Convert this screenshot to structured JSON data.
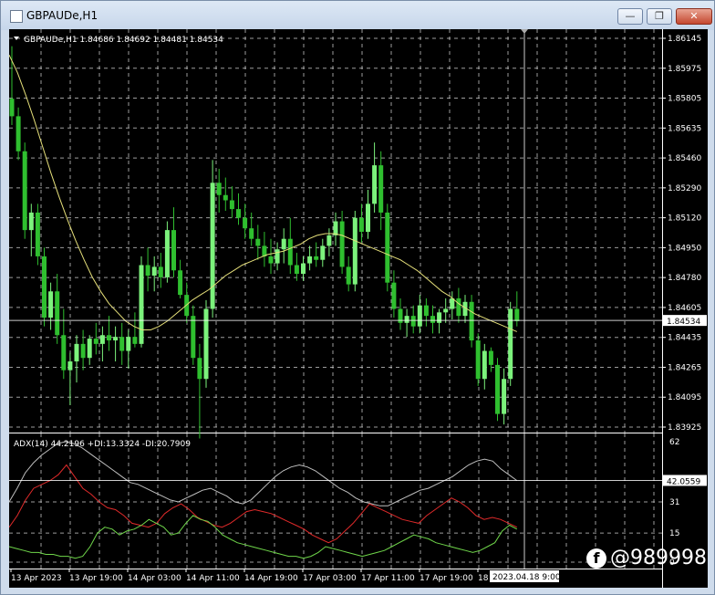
{
  "window": {
    "title": "GBPAUDe,H1",
    "minimize_glyph": "—",
    "restore_glyph": "❐",
    "close_glyph": "✕"
  },
  "main_panel": {
    "header": "GBPAUDe,H1  1.84686 1.84692 1.84481 1.84534",
    "price_labels": [
      "1.86145",
      "1.85975",
      "1.85805",
      "1.85635",
      "1.85460",
      "1.85290",
      "1.85120",
      "1.84950",
      "1.84780",
      "1.84605",
      "1.84435",
      "1.84265",
      "1.84095",
      "1.83925"
    ],
    "current_price": "1.84534"
  },
  "adx_panel": {
    "header": "ADX(14) 44.2196 +DI:13.3324 -DI:20.7909",
    "level_labels": [
      "62",
      "31",
      "15",
      "0"
    ],
    "current_value": "42.0559"
  },
  "time_axis": {
    "labels": [
      "13 Apr 2023",
      "13 Apr 19:00",
      "14 Apr 03:00",
      "14 Apr 11:00",
      "14 Apr 19:00",
      "17 Apr 03:00",
      "17 Apr 11:00",
      "17 Apr 19:00",
      "18"
    ],
    "crosshair_time": "2023.04.18 9:00"
  },
  "colors": {
    "bull": "#7cf27c",
    "bear": "#2fbf2f",
    "ma": "#e6e07a",
    "adx": "#bfbfbf",
    "plus_di": "#6fd64a",
    "minus_di": "#e02a2a",
    "grid": "#d0d0d0"
  },
  "watermark": {
    "icon": "f",
    "text": "@989998"
  },
  "chart_data": {
    "type": "candlestick",
    "x_range": [
      "2023-04-13",
      "2023-04-18 09:00"
    ],
    "y_range": [
      1.83925,
      1.86145
    ],
    "ohlc": [
      [
        1.858,
        1.861,
        1.8565,
        1.857
      ],
      [
        1.857,
        1.8575,
        1.8545,
        1.855
      ],
      [
        1.855,
        1.8555,
        1.85,
        1.8505
      ],
      [
        1.8505,
        1.852,
        1.849,
        1.8515
      ],
      [
        1.8515,
        1.852,
        1.8485,
        1.849
      ],
      [
        1.849,
        1.8495,
        1.845,
        1.8455
      ],
      [
        1.8455,
        1.8475,
        1.8448,
        1.847
      ],
      [
        1.847,
        1.848,
        1.844,
        1.8445
      ],
      [
        1.8445,
        1.846,
        1.842,
        1.8425
      ],
      [
        1.8425,
        1.8435,
        1.8405,
        1.843
      ],
      [
        1.843,
        1.8445,
        1.8418,
        1.844
      ],
      [
        1.844,
        1.8448,
        1.8425,
        1.8432
      ],
      [
        1.8432,
        1.8445,
        1.8428,
        1.8443
      ],
      [
        1.8443,
        1.8452,
        1.8434,
        1.844
      ],
      [
        1.844,
        1.845,
        1.843,
        1.8445
      ],
      [
        1.8445,
        1.8456,
        1.8436,
        1.8442
      ],
      [
        1.8442,
        1.845,
        1.843,
        1.8444
      ],
      [
        1.8444,
        1.8452,
        1.8428,
        1.8436
      ],
      [
        1.8436,
        1.8448,
        1.8426,
        1.8444
      ],
      [
        1.8444,
        1.8458,
        1.8438,
        1.844
      ],
      [
        1.844,
        1.849,
        1.8438,
        1.8485
      ],
      [
        1.8485,
        1.8495,
        1.847,
        1.8479
      ],
      [
        1.8479,
        1.849,
        1.847,
        1.8484
      ],
      [
        1.8484,
        1.8492,
        1.8472,
        1.8478
      ],
      [
        1.8478,
        1.851,
        1.8475,
        1.8505
      ],
      [
        1.8505,
        1.8518,
        1.8478,
        1.8482
      ],
      [
        1.8482,
        1.8488,
        1.8466,
        1.8468
      ],
      [
        1.8468,
        1.8475,
        1.8452,
        1.8456
      ],
      [
        1.8456,
        1.8462,
        1.8428,
        1.8432
      ],
      [
        1.8432,
        1.844,
        1.8386,
        1.842
      ],
      [
        1.842,
        1.8465,
        1.8415,
        1.846
      ],
      [
        1.846,
        1.8545,
        1.8455,
        1.8532
      ],
      [
        1.8532,
        1.854,
        1.8515,
        1.8525
      ],
      [
        1.8525,
        1.8535,
        1.8516,
        1.8522
      ],
      [
        1.8522,
        1.853,
        1.8512,
        1.8517
      ],
      [
        1.8517,
        1.8526,
        1.8508,
        1.8512
      ],
      [
        1.8512,
        1.852,
        1.85,
        1.8506
      ],
      [
        1.8506,
        1.8515,
        1.8496,
        1.85
      ],
      [
        1.85,
        1.8508,
        1.8488,
        1.8496
      ],
      [
        1.8496,
        1.8504,
        1.8484,
        1.849
      ],
      [
        1.849,
        1.85,
        1.848,
        1.8486
      ],
      [
        1.8486,
        1.8498,
        1.8482,
        1.8494
      ],
      [
        1.8494,
        1.8506,
        1.8486,
        1.85
      ],
      [
        1.85,
        1.8512,
        1.848,
        1.8485
      ],
      [
        1.8485,
        1.8492,
        1.8476,
        1.848
      ],
      [
        1.848,
        1.849,
        1.8476,
        1.8486
      ],
      [
        1.8486,
        1.8496,
        1.8482,
        1.849
      ],
      [
        1.849,
        1.8498,
        1.8484,
        1.8488
      ],
      [
        1.8488,
        1.85,
        1.8484,
        1.8496
      ],
      [
        1.8496,
        1.8506,
        1.849,
        1.8502
      ],
      [
        1.8502,
        1.8515,
        1.8496,
        1.851
      ],
      [
        1.851,
        1.8516,
        1.848,
        1.8484
      ],
      [
        1.8484,
        1.849,
        1.847,
        1.8474
      ],
      [
        1.8474,
        1.8516,
        1.847,
        1.8512
      ],
      [
        1.8512,
        1.852,
        1.8498,
        1.8504
      ],
      [
        1.8504,
        1.8528,
        1.85,
        1.852
      ],
      [
        1.852,
        1.8555,
        1.8515,
        1.8542
      ],
      [
        1.8542,
        1.855,
        1.8505,
        1.8515
      ],
      [
        1.8515,
        1.852,
        1.847,
        1.8475
      ],
      [
        1.8475,
        1.8482,
        1.8455,
        1.846
      ],
      [
        1.846,
        1.8466,
        1.8448,
        1.8452
      ],
      [
        1.8452,
        1.846,
        1.8444,
        1.8456
      ],
      [
        1.8456,
        1.8462,
        1.8446,
        1.845
      ],
      [
        1.845,
        1.8468,
        1.8446,
        1.8462
      ],
      [
        1.8462,
        1.8466,
        1.845,
        1.8456
      ],
      [
        1.8456,
        1.8462,
        1.8446,
        1.8452
      ],
      [
        1.8452,
        1.846,
        1.8446,
        1.8458
      ],
      [
        1.8458,
        1.8466,
        1.8452,
        1.846
      ],
      [
        1.846,
        1.847,
        1.8454,
        1.8466
      ],
      [
        1.8466,
        1.8472,
        1.8452,
        1.8456
      ],
      [
        1.8456,
        1.8468,
        1.8452,
        1.8464
      ],
      [
        1.8464,
        1.8468,
        1.8438,
        1.8442
      ],
      [
        1.8442,
        1.8446,
        1.8416,
        1.842
      ],
      [
        1.842,
        1.844,
        1.8414,
        1.8436
      ],
      [
        1.8436,
        1.8438,
        1.8424,
        1.8428
      ],
      [
        1.8428,
        1.8432,
        1.8396,
        1.84
      ],
      [
        1.84,
        1.8426,
        1.8394,
        1.842
      ],
      [
        1.842,
        1.8464,
        1.8416,
        1.846
      ],
      [
        1.846,
        1.847,
        1.845,
        1.8453
      ]
    ],
    "ma": [
      1.8605,
      1.8595,
      1.8582,
      1.8568,
      1.8553,
      1.8538,
      1.8524,
      1.8511,
      1.8499,
      1.8488,
      1.8478,
      1.847,
      1.8463,
      1.8458,
      1.8453,
      1.845,
      1.8448,
      1.8448,
      1.845,
      1.8453,
      1.8457,
      1.8461,
      1.8465,
      1.8468,
      1.8471,
      1.8475,
      1.8479,
      1.8482,
      1.8485,
      1.8487,
      1.8489,
      1.8491,
      1.8492,
      1.8493,
      1.8495,
      1.8497,
      1.85,
      1.8502,
      1.8503,
      1.8503,
      1.8502,
      1.85,
      1.8498,
      1.8496,
      1.8494,
      1.8492,
      1.849,
      1.8488,
      1.8485,
      1.8482,
      1.8478,
      1.8474,
      1.847,
      1.8467,
      1.8463,
      1.846,
      1.8457,
      1.8455,
      1.8453,
      1.8451,
      1.8449,
      1.8447
    ],
    "adx": [
      31,
      38,
      46,
      51,
      55,
      58,
      61,
      62,
      61,
      59,
      56,
      53,
      50,
      47,
      44,
      41,
      40,
      38,
      36,
      34,
      32,
      31,
      33,
      35,
      37,
      38,
      36,
      34,
      31,
      30,
      32,
      36,
      40,
      44,
      47,
      49,
      50,
      49,
      47,
      44,
      41,
      38,
      36,
      33,
      31,
      30,
      29,
      29,
      31,
      33,
      35,
      37,
      38,
      40,
      42,
      44,
      47,
      50,
      52,
      53,
      52,
      48,
      45,
      42
    ],
    "plus_di": [
      8,
      7,
      6,
      5,
      5,
      4,
      4,
      3,
      3,
      2,
      3,
      8,
      15,
      18,
      17,
      14,
      16,
      17,
      19,
      22,
      20,
      18,
      14,
      15,
      20,
      24,
      22,
      21,
      18,
      14,
      12,
      10,
      9,
      8,
      7,
      6,
      5,
      4,
      3,
      3,
      2,
      3,
      5,
      8,
      7,
      6,
      5,
      4,
      3,
      4,
      5,
      6,
      8,
      10,
      12,
      14,
      13,
      12,
      10,
      9,
      8,
      7,
      6,
      5,
      6,
      8,
      10,
      16,
      19,
      17
    ],
    "minus_di": [
      18,
      24,
      32,
      38,
      40,
      42,
      45,
      50,
      44,
      38,
      35,
      31,
      28,
      27,
      24,
      20,
      19,
      18,
      20,
      25,
      28,
      30,
      27,
      23,
      21,
      19,
      18,
      20,
      23,
      26,
      27,
      26,
      25,
      23,
      21,
      19,
      17,
      14,
      12,
      10,
      12,
      16,
      20,
      25,
      30,
      28,
      26,
      24,
      22,
      21,
      20,
      24,
      27,
      30,
      33,
      31,
      28,
      24,
      22,
      23,
      22,
      20,
      18
    ],
    "adx_range": [
      0,
      62
    ],
    "crosshair_price": 1.84534,
    "crosshair_adx": 42.0559
  }
}
